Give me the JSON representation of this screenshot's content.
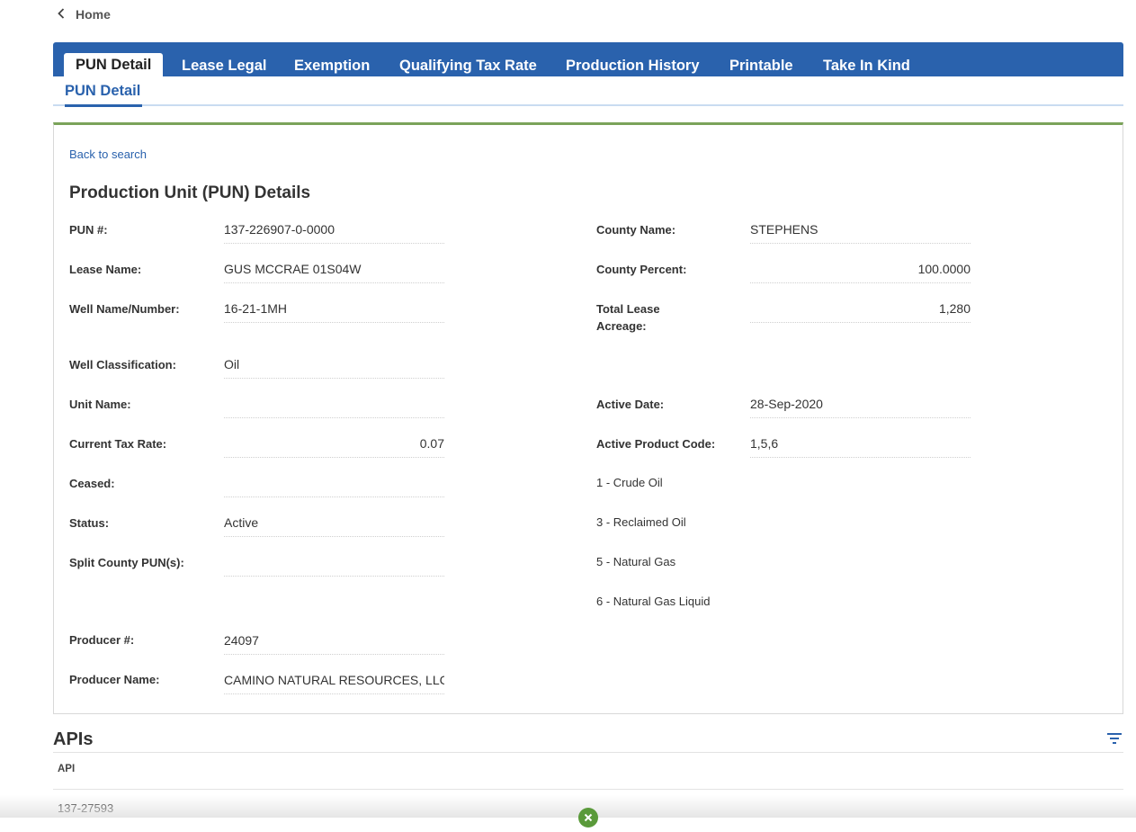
{
  "nav": {
    "back_label": "Home"
  },
  "tabs": [
    {
      "label": "PUN Detail",
      "active": true
    },
    {
      "label": "Lease Legal"
    },
    {
      "label": "Exemption"
    },
    {
      "label": "Qualifying Tax Rate"
    },
    {
      "label": "Production History"
    },
    {
      "label": "Printable"
    },
    {
      "label": "Take In Kind"
    }
  ],
  "subtab": {
    "label": "PUN Detail"
  },
  "detail": {
    "back_to_search": "Back to search",
    "title": "Production Unit (PUN) Details",
    "left_fields": [
      {
        "label": "PUN #:",
        "value": "137-226907-0-0000"
      },
      {
        "label": "Lease Name:",
        "value": "GUS MCCRAE 01S04W"
      },
      {
        "label": "Well Name/Number:",
        "value": "16-21-1MH"
      },
      {
        "label": "Well Classification:",
        "value": "Oil"
      },
      {
        "label": "Unit Name:",
        "value": ""
      },
      {
        "label": "Current Tax Rate:",
        "value": "0.07"
      },
      {
        "label": "Ceased:",
        "value": ""
      },
      {
        "label": "Status:",
        "value": "Active"
      },
      {
        "label": "Split County PUN(s):",
        "value": ""
      },
      {
        "label": "Producer #:",
        "value": "24097"
      },
      {
        "label": "Producer Name:",
        "value": "CAMINO NATURAL RESOURCES, LLC"
      }
    ],
    "right_fields": [
      {
        "label": "County Name:",
        "value": "STEPHENS"
      },
      {
        "label": "County Percent:",
        "value": "100.0000"
      },
      {
        "label": "Total Lease Acreage:",
        "value": "1,280"
      },
      {
        "label": "Active Date:",
        "value": "28-Sep-2020"
      },
      {
        "label": "Active Product Code:",
        "value": "1,5,6"
      }
    ],
    "product_codes": [
      "1 - Crude Oil",
      "3 - Reclaimed Oil",
      "5 - Natural Gas",
      "6 - Natural Gas Liquid"
    ]
  },
  "apis": {
    "title": "APIs",
    "column_header": "API",
    "rows": [
      "137-27593"
    ]
  },
  "colors": {
    "tab_bar": "#2a62ad",
    "card_accent": "#7aa35a",
    "link": "#2a62ad",
    "close_badge": "#5a9a3a"
  },
  "icons": {
    "back": "chevron-left-icon",
    "filter": "filter-icon",
    "close": "close-icon"
  }
}
